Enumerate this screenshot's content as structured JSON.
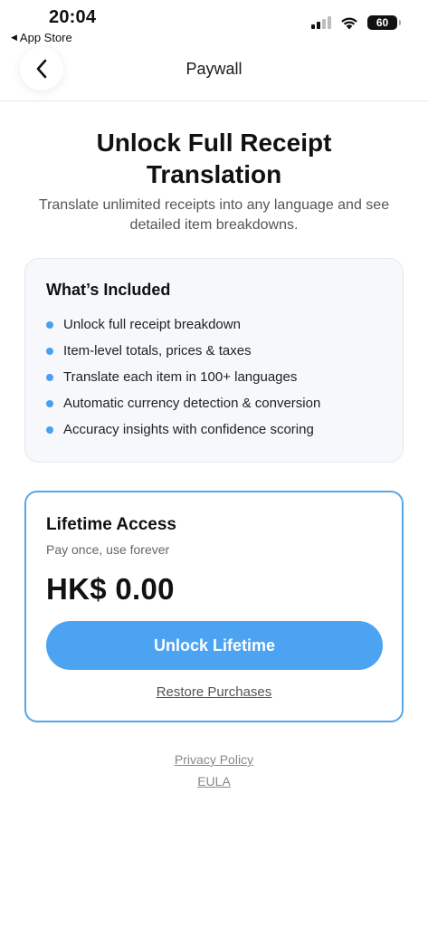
{
  "status_bar": {
    "time": "20:04",
    "back_app_label": "App Store",
    "battery": "60"
  },
  "nav": {
    "title": "Paywall"
  },
  "header": {
    "title": "Unlock Full Receipt Translation",
    "subtitle": "Translate unlimited receipts into any language and see detailed item breakdowns."
  },
  "included": {
    "title": "What’s Included",
    "items": [
      "Unlock full receipt breakdown",
      "Item-level totals, prices & taxes",
      "Translate each item in 100+ languages",
      "Automatic currency detection & conversion",
      "Accuracy insights with confidence scoring"
    ]
  },
  "plan": {
    "title": "Lifetime Access",
    "subtitle": "Pay once, use forever",
    "price": "HK$ 0.00",
    "button_label": "Unlock Lifetime",
    "restore_label": "Restore Purchases"
  },
  "footer": {
    "privacy_label": "Privacy Policy",
    "eula_label": "EULA"
  },
  "colors": {
    "accent": "#4ba3f2",
    "card_border": "#57a6ea",
    "bullet": "#4a9ff0"
  }
}
